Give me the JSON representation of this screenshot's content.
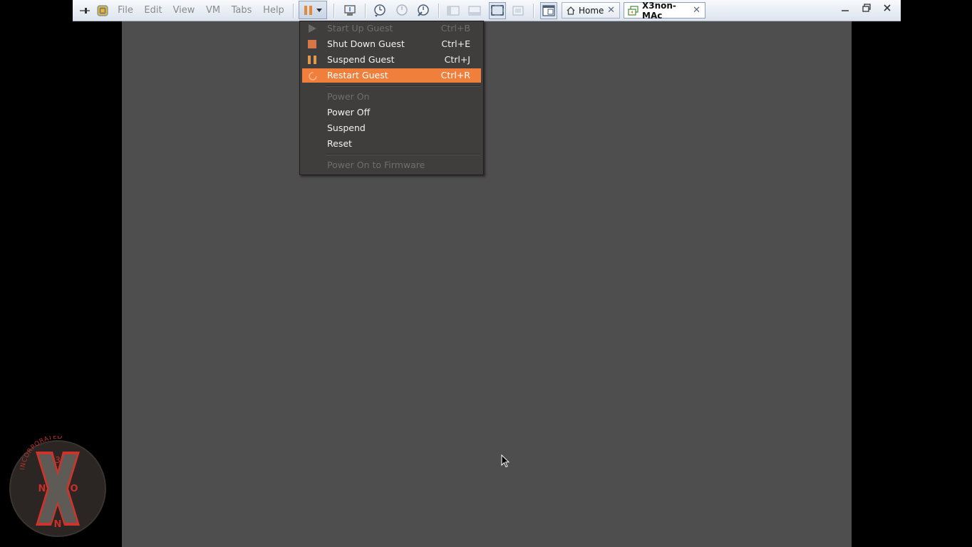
{
  "menubar": {
    "items": [
      {
        "label": "File"
      },
      {
        "label": "Edit"
      },
      {
        "label": "View"
      },
      {
        "label": "VM"
      },
      {
        "label": "Tabs"
      },
      {
        "label": "Help"
      }
    ]
  },
  "tabs": [
    {
      "label": "Home",
      "icon": "home-icon"
    },
    {
      "label": "X3non-MAc",
      "icon": "vm-icon"
    }
  ],
  "power_menu": {
    "items": [
      {
        "label": "Start Up Guest",
        "shortcut": "Ctrl+B",
        "enabled": false,
        "icon": "play-icon"
      },
      {
        "label": "Shut Down Guest",
        "shortcut": "Ctrl+E",
        "enabled": true,
        "icon": "stop-icon"
      },
      {
        "label": "Suspend Guest",
        "shortcut": "Ctrl+J",
        "enabled": true,
        "icon": "pause-icon"
      },
      {
        "label": "Restart Guest",
        "shortcut": "Ctrl+R",
        "enabled": true,
        "highlighted": true,
        "icon": "restart-icon"
      },
      {
        "label": "Power On",
        "shortcut": "",
        "enabled": false
      },
      {
        "label": "Power Off",
        "shortcut": "",
        "enabled": true
      },
      {
        "label": "Suspend",
        "shortcut": "",
        "enabled": true
      },
      {
        "label": "Reset",
        "shortcut": "",
        "enabled": true
      },
      {
        "label": "Power On to Firmware",
        "shortcut": "",
        "enabled": false
      }
    ]
  },
  "logo": {
    "top_text": "INCORPORATED",
    "letters": [
      "3",
      "N",
      "X",
      "O",
      "N"
    ]
  },
  "colors": {
    "accent": "#f07f3c",
    "vm_background": "#4f4e4f",
    "menu_background": "#3f3e3d"
  }
}
